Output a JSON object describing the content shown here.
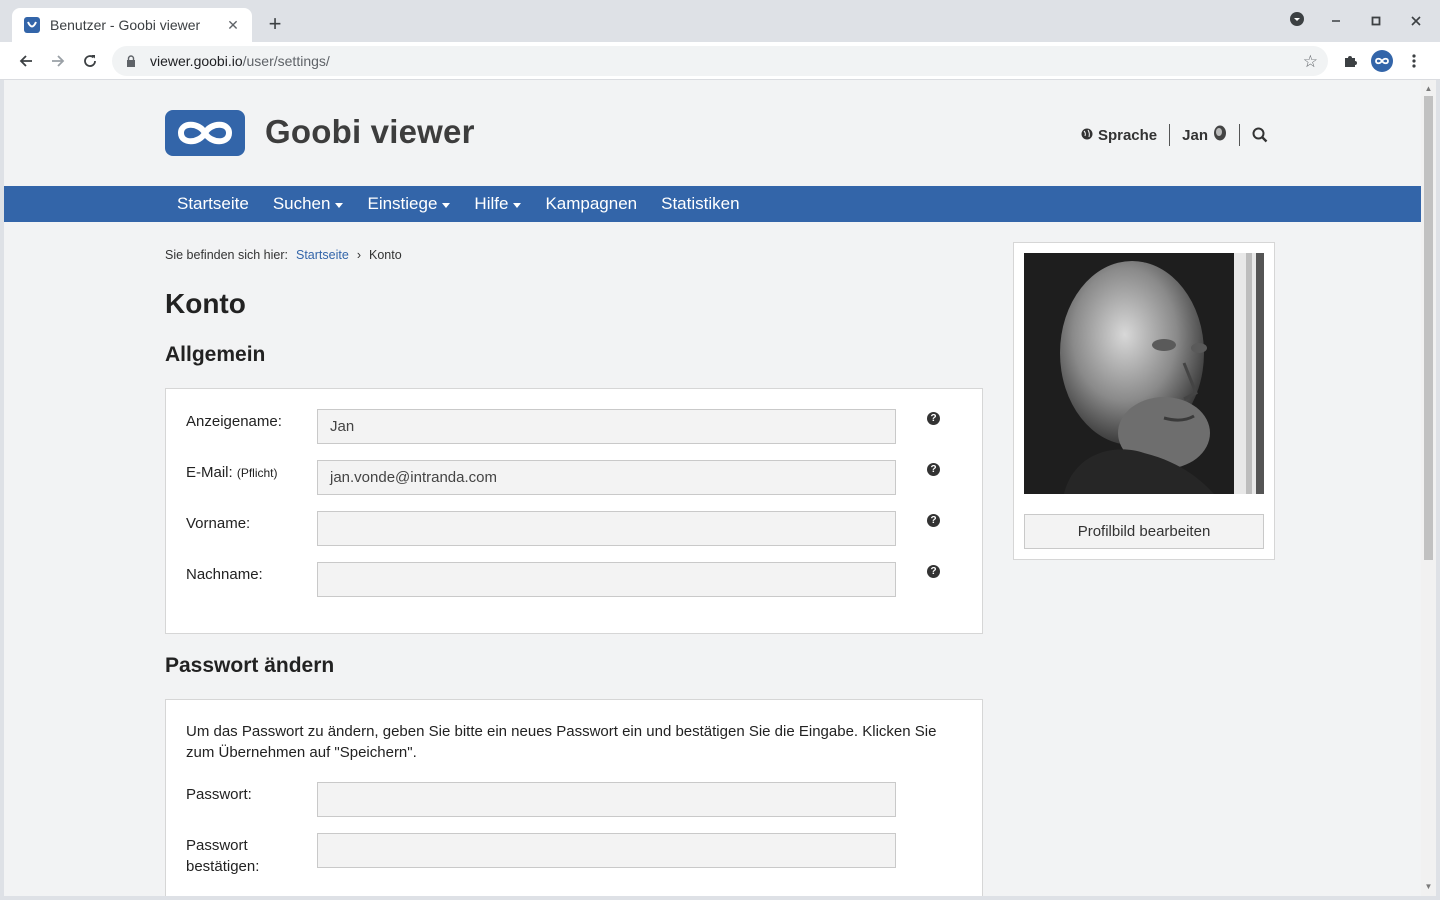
{
  "browser": {
    "tab_title": "Benutzer - Goobi viewer",
    "tab_close": "✕",
    "new_tab": "+",
    "url_host": "viewer.goobi.io",
    "url_path": "/user/settings/"
  },
  "header": {
    "brand": "Goobi viewer",
    "language_label": "Sprache",
    "user_label": "Jan"
  },
  "nav": {
    "items": [
      {
        "label": "Startseite",
        "dropdown": false
      },
      {
        "label": "Suchen",
        "dropdown": true
      },
      {
        "label": "Einstiege",
        "dropdown": true
      },
      {
        "label": "Hilfe",
        "dropdown": true
      },
      {
        "label": "Kampagnen",
        "dropdown": false
      },
      {
        "label": "Statistiken",
        "dropdown": false
      }
    ]
  },
  "breadcrumb": {
    "prefix": "Sie befinden sich hier:",
    "home": "Startseite",
    "separator": "›",
    "current": "Konto"
  },
  "page_title": "Konto",
  "general": {
    "heading": "Allgemein",
    "fields": [
      {
        "label": "Anzeigename:",
        "note": "",
        "value": "Jan"
      },
      {
        "label": "E-Mail:",
        "note": "(Pflicht)",
        "value": "jan.vonde@intranda.com"
      },
      {
        "label": "Vorname:",
        "note": "",
        "value": ""
      },
      {
        "label": "Nachname:",
        "note": "",
        "value": ""
      }
    ],
    "help_glyph": "?"
  },
  "password": {
    "heading": "Passwort ändern",
    "text": "Um das Passwort zu ändern, geben Sie bitte ein neues Passwort ein und bestätigen Sie die Eingabe. Klicken Sie zum Übernehmen auf \"Speichern\".",
    "password_label": "Passwort:",
    "confirm_label_1": "Passwort",
    "confirm_label_2": "bestätigen:",
    "password_value": "",
    "confirm_value": ""
  },
  "sidebar": {
    "edit_photo_label": "Profilbild bearbeiten"
  },
  "colors": {
    "brand_blue": "#3365a9",
    "page_bg": "#f2f3f4"
  }
}
